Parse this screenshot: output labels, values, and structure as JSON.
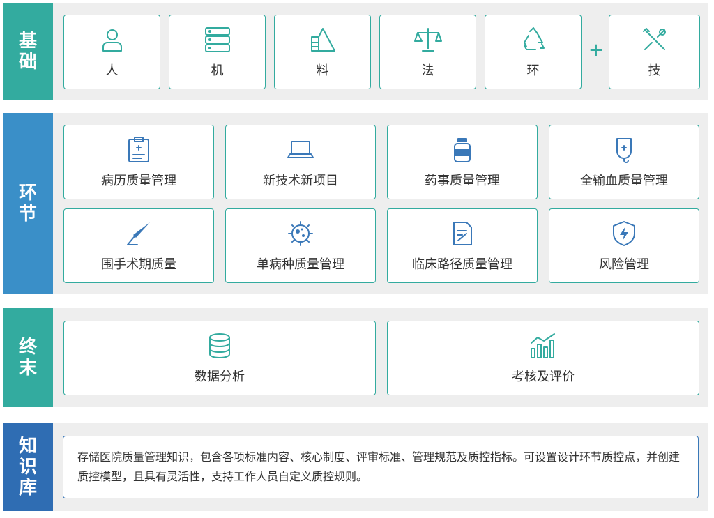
{
  "sections": {
    "foundation": {
      "label": [
        "基",
        "础"
      ],
      "color": "#33ab9f",
      "items": [
        {
          "label": "人",
          "icon": "person-icon"
        },
        {
          "label": "机",
          "icon": "server-icon"
        },
        {
          "label": "料",
          "icon": "material-icon"
        },
        {
          "label": "法",
          "icon": "scale-icon"
        },
        {
          "label": "环",
          "icon": "recycle-icon"
        },
        {
          "label": "技",
          "icon": "tools-icon"
        }
      ],
      "plus": "+"
    },
    "process": {
      "label": [
        "环",
        "节"
      ],
      "color": "#3a8fc8",
      "items": [
        {
          "label": "病历质量管理",
          "icon": "medical-record-icon"
        },
        {
          "label": "新技术新项目",
          "icon": "laptop-icon"
        },
        {
          "label": "药事质量管理",
          "icon": "medicine-bottle-icon"
        },
        {
          "label": "全输血质量管理",
          "icon": "blood-bag-icon"
        },
        {
          "label": "围手术期质量",
          "icon": "scalpel-icon"
        },
        {
          "label": "单病种质量管理",
          "icon": "virus-icon"
        },
        {
          "label": "临床路径质量管理",
          "icon": "document-edit-icon"
        },
        {
          "label": "风险管理",
          "icon": "shield-alert-icon"
        }
      ]
    },
    "terminal": {
      "label": [
        "终",
        "末"
      ],
      "color": "#33ab9f",
      "items": [
        {
          "label": "数据分析",
          "icon": "database-icon"
        },
        {
          "label": "考核及评价",
          "icon": "bar-chart-icon"
        }
      ]
    },
    "knowledge": {
      "label": [
        "知",
        "识",
        "库"
      ],
      "color": "#2f6db3",
      "text": "存储医院质量管理知识，包含各项标准内容、核心制度、评审标准、管理规范及质控指标。可设置设计环节质控点，并创建质控模型，且具有灵活性，支持工作人员自定义质控规则。"
    }
  }
}
